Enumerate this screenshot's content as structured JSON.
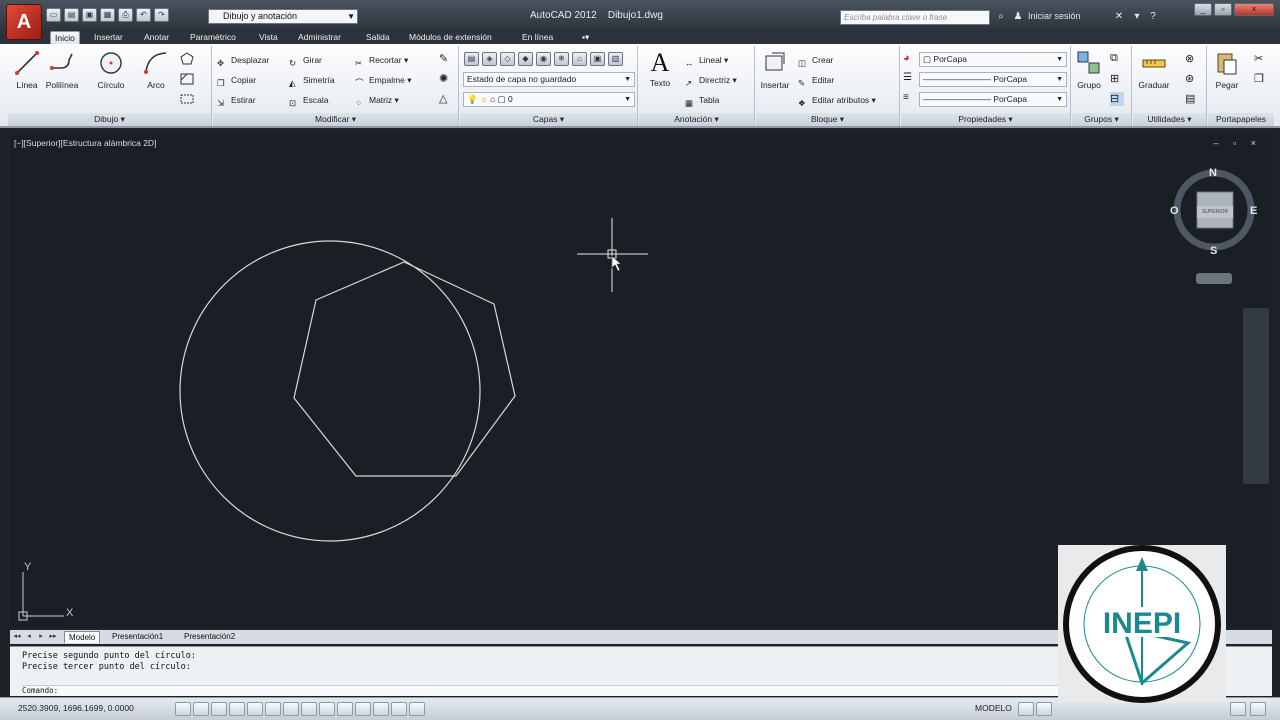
{
  "titlebar": {
    "workspace": "Dibujo y anotación",
    "app_name": "AutoCAD 2012",
    "file_name": "Dibujo1.dwg",
    "search_placeholder": "Escriba palabra clave o frase",
    "signin": "Iniciar sesión"
  },
  "tabs": [
    "Inicio",
    "Insertar",
    "Anotar",
    "Paramétrico",
    "Vista",
    "Administrar",
    "Salida",
    "Módulos de extensión",
    "En línea"
  ],
  "ribbon": {
    "dibujo": {
      "title": "Dibujo",
      "linea": "Línea",
      "polilinea": "Polilínea",
      "circulo": "Círculo",
      "arco": "Arco"
    },
    "modificar": {
      "title": "Modificar",
      "desplazar": "Desplazar",
      "girar": "Girar",
      "recortar": "Recortar",
      "copiar": "Copiar",
      "simetria": "Simetría",
      "empalme": "Empalme",
      "estirar": "Estirar",
      "escala": "Escala",
      "matriz": "Matriz"
    },
    "capas": {
      "title": "Capas",
      "estado": "Estado de capa no guardado",
      "layer": "0"
    },
    "anotacion": {
      "title": "Anotación",
      "texto": "Texto",
      "lineal": "Lineal",
      "directriz": "Directriz",
      "tabla": "Tabla"
    },
    "bloque": {
      "title": "Bloque",
      "insertar": "Insertar",
      "crear": "Crear",
      "editar": "Editar",
      "editar_atributos": "Editar atributos"
    },
    "propiedades": {
      "title": "Propiedades",
      "color": "PorCapa",
      "linetype": "PorCapa",
      "lineweight": "PorCapa"
    },
    "grupos": {
      "title": "Grupos",
      "grupo": "Grupo"
    },
    "utilidades": {
      "title": "Utilidades",
      "graduar": "Graduar"
    },
    "portapapeles": {
      "title": "Portapapeles",
      "pegar": "Pegar"
    }
  },
  "viewport": {
    "label": "[−][Superior][Estructura alámbrica 2D]",
    "controls": "– ▫ ×",
    "compass": {
      "n": "N",
      "s": "S",
      "e": "E",
      "o": "O"
    },
    "cube_face": "SUPERIOR"
  },
  "layout_tabs": [
    "Modelo",
    "Presentación1",
    "Presentación2"
  ],
  "command": {
    "lines": [
      "Precise segundo punto del círculo:",
      "Precise tercer punto del círculo:"
    ],
    "prompt": "Comando:"
  },
  "status": {
    "coords": "2520.3909, 1696.1699, 0.0000",
    "space": "MODELO"
  },
  "logo": {
    "text": "INEPI"
  },
  "colors": {
    "canvas": "#1a1f26",
    "geometry": "#d8d8d8",
    "accent_red": "#c9302c",
    "logo_teal": "#1a8a8f"
  }
}
